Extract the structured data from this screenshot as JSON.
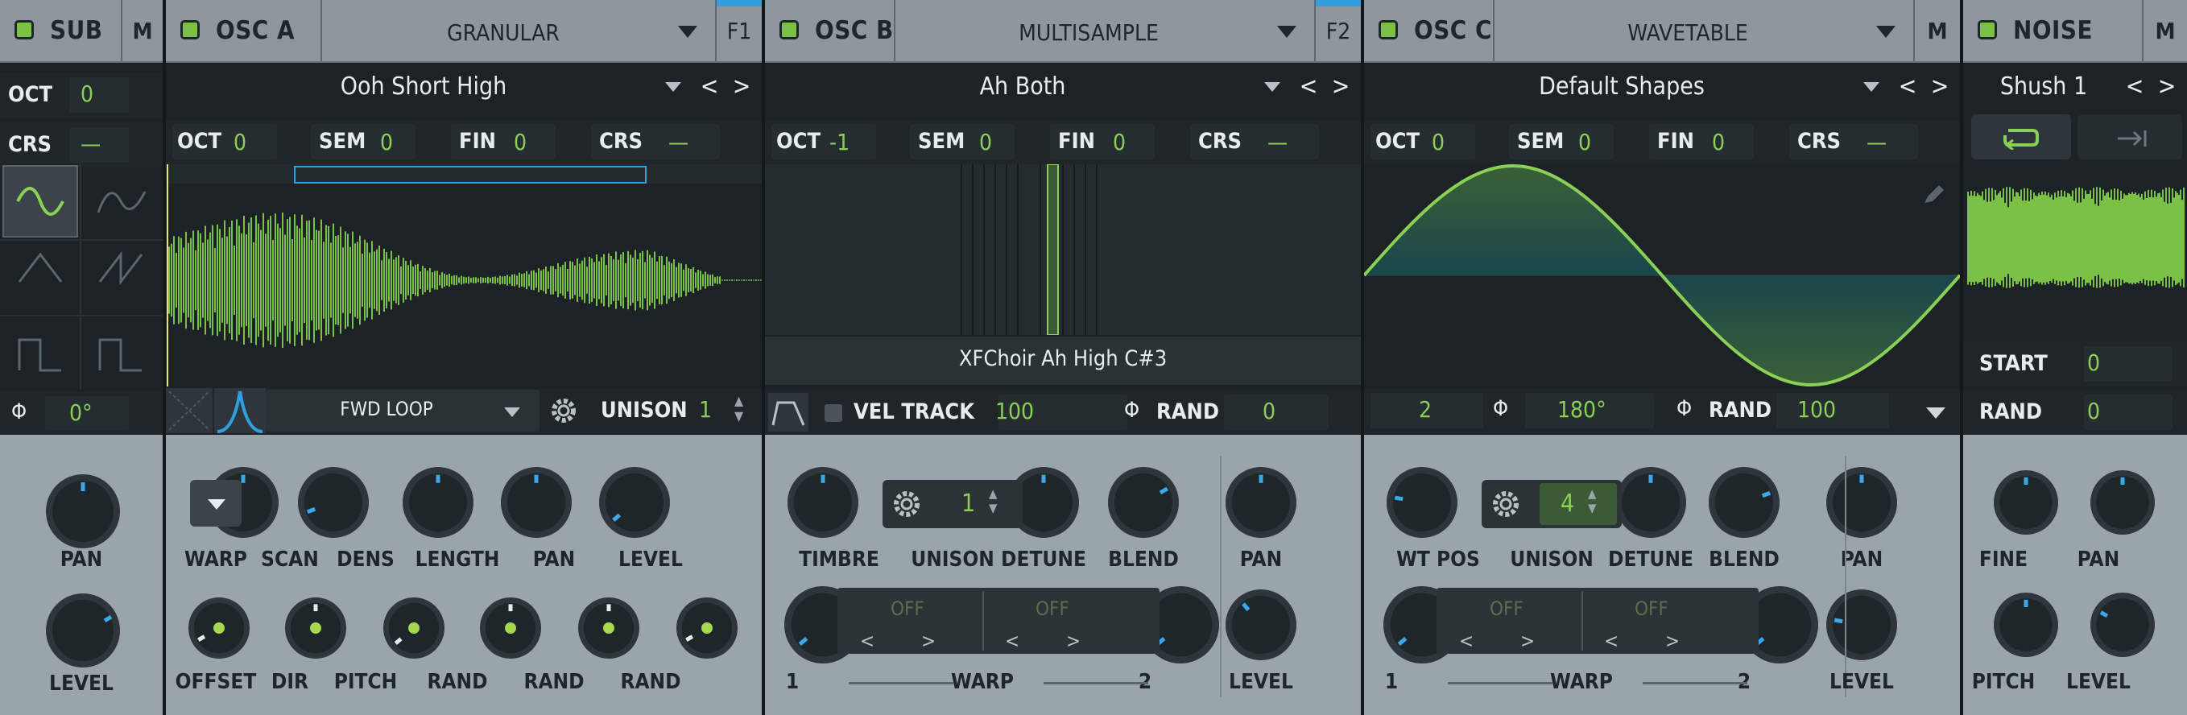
{
  "colors": {
    "accent": "#7bc146",
    "blue": "#2f9fe0",
    "panel": "#1c2225",
    "header": "#8e979e"
  },
  "sub": {
    "name": "SUB",
    "m": "M",
    "oct_label": "OCT",
    "oct_value": "0",
    "crs_label": "CRS",
    "crs_value": "—",
    "phase_value": "0°",
    "knobs": [
      {
        "label": "PAN"
      },
      {
        "label": "LEVEL"
      }
    ]
  },
  "osc_a": {
    "name": "OSC A",
    "type": "GRANULAR",
    "f": "F1",
    "preset": "Ooh Short High",
    "oct_label": "OCT",
    "oct_value": "0",
    "sem_label": "SEM",
    "sem_value": "0",
    "fin_label": "FIN",
    "fin_value": "0",
    "crs_label": "CRS",
    "crs_value": "—",
    "loop_mode": "FWD LOOP",
    "unison_label": "UNISON",
    "unison_value": "1",
    "knobs_top": [
      "WARP",
      "SCAN",
      "DENS",
      "LENGTH",
      "PAN",
      "LEVEL"
    ],
    "knobs_bottom": [
      "OFFSET",
      "DIR",
      "PITCH",
      "RAND",
      "RAND",
      "RAND"
    ]
  },
  "osc_b": {
    "name": "OSC B",
    "type": "MULTISAMPLE",
    "f": "F2",
    "preset": "Ah Both",
    "oct_label": "OCT",
    "oct_value": "-1",
    "sem_label": "SEM",
    "sem_value": "0",
    "fin_label": "FIN",
    "fin_value": "0",
    "crs_label": "CRS",
    "crs_value": "—",
    "sample_name": "XFChoir Ah High C#3",
    "vel_label": "VEL TRACK",
    "vel_value": "100",
    "rand_label": "RAND",
    "rand_value": "0",
    "knobs_top": [
      "TIMBRE",
      "UNISON",
      "DETUNE",
      "BLEND",
      "PAN"
    ],
    "unison_value": "1",
    "warp1": "OFF",
    "warp2": "OFF",
    "warp_label": "WARP",
    "warp_n1": "1",
    "warp_n2": "2",
    "level_label": "LEVEL"
  },
  "osc_c": {
    "name": "OSC C",
    "type": "WAVETABLE",
    "m": "M",
    "preset": "Default Shapes",
    "oct_label": "OCT",
    "oct_value": "0",
    "sem_label": "SEM",
    "sem_value": "0",
    "fin_label": "FIN",
    "fin_value": "0",
    "crs_label": "CRS",
    "crs_value": "—",
    "frame_value": "2",
    "phase_value": "180°",
    "rand_label": "RAND",
    "rand_value": "100",
    "knobs_top": [
      "WT POS",
      "UNISON",
      "DETUNE",
      "BLEND",
      "PAN"
    ],
    "unison_value": "4",
    "warp1": "OFF",
    "warp2": "OFF",
    "warp_label": "WARP",
    "warp_n1": "1",
    "warp_n2": "2",
    "level_label": "LEVEL"
  },
  "noise": {
    "name": "NOISE",
    "m": "M",
    "preset": "Shush 1",
    "start_label": "START",
    "start_value": "0",
    "rand_label": "RAND",
    "rand_value": "0",
    "knobs": [
      "FINE",
      "PAN",
      "PITCH",
      "LEVEL"
    ]
  },
  "nav": {
    "prev": "<",
    "next": ">"
  }
}
